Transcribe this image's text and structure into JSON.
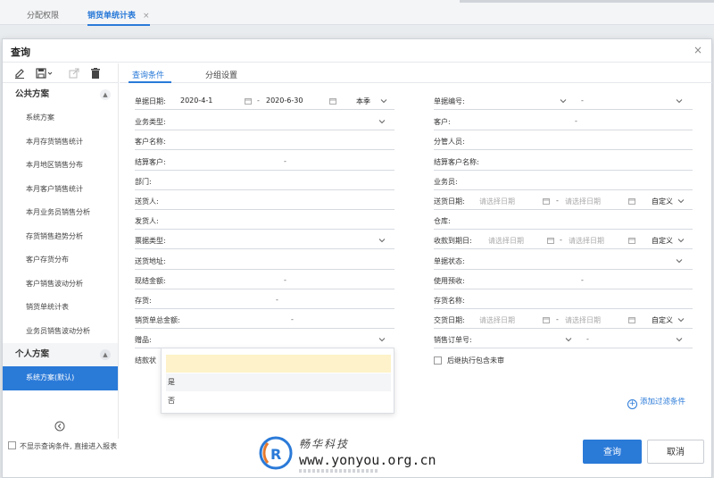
{
  "bg_tabs": [
    {
      "label": "分配权限",
      "active": false
    },
    {
      "label": "销货单统计表",
      "active": true,
      "close": "×"
    }
  ],
  "modal": {
    "title": "查询",
    "close": "×"
  },
  "sidebar": {
    "public_title": "公共方案",
    "public_items": [
      "系统方案",
      "本月存货销售统计",
      "本月地区销售分布",
      "本月客户销售统计",
      "本月业务员销售分析",
      "存货销售趋势分析",
      "客户存货分布",
      "客户销售波动分析",
      "销货单统计表",
      "业务员销售波动分析"
    ],
    "personal_title": "个人方案",
    "personal_items": [
      "系统方案(默认)"
    ]
  },
  "tabs": [
    "查询条件",
    "分组设置"
  ],
  "left_fields": {
    "doc_date": {
      "label": "单据日期:",
      "from": "2020-4-1",
      "to": "2020-6-30",
      "preset": "本季"
    },
    "biz_type": "业务类型:",
    "customer_name": "客户名称:",
    "settle_customer": "结算客户:",
    "dept": "部门:",
    "delivery_person": "送货人:",
    "shipper": "发货人:",
    "invoice_type": "票据类型:",
    "delivery_addr": "送货地址:",
    "cash_amount": "现结金额:",
    "inventory": "存货:",
    "total_amount": "销货单总金额:",
    "gift": "赠品:",
    "settle_status": "结款状"
  },
  "right_fields": {
    "doc_no": "单据编号:",
    "customer": "客户:",
    "manager": "分管人员:",
    "settle_customer_name": "结算客户名称:",
    "salesman": "业务员:",
    "delivery_date": {
      "label": "送货日期:",
      "placeholder": "请选择日期",
      "preset": "自定义"
    },
    "warehouse": "仓库:",
    "due_date": {
      "label": "收款到期日:",
      "placeholder": "请选择日期",
      "preset": "自定义"
    },
    "doc_status": "单据状态:",
    "use_prepay": "使用预收:",
    "inventory_name": "存货名称:",
    "trade_date": {
      "label": "交货日期:",
      "placeholder": "请选择日期",
      "preset": "自定义"
    },
    "sales_order_no": "销售订单号:",
    "include_unexec": "后继执行包含未审"
  },
  "dash": "-",
  "dropdown": {
    "options": [
      "",
      "是",
      "否"
    ]
  },
  "add_filter": "添加过滤条件",
  "footer": {
    "skip_label": "不显示查询条件, 直接进入报表",
    "query_btn": "查询",
    "cancel_btn": "取消"
  },
  "watermark": {
    "cn": "畅华科技",
    "url": "www.yonyou.org.cn"
  },
  "colors": {
    "accent": "#2a7ad8",
    "selected_option": "#fdf2c9"
  }
}
